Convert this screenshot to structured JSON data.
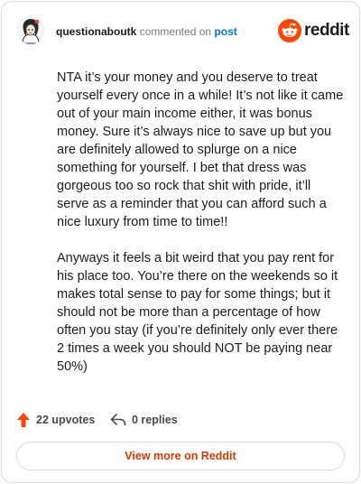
{
  "header": {
    "username": "questionaboutk",
    "verb": "commented on",
    "post_link": "post",
    "brand_name": "reddit"
  },
  "comment": {
    "paragraphs": [
      "NTA it’s your money and you deserve to treat yourself every once in a while! It’s not like it came out of your main income either, it was bonus money. Sure it’s always nice to save up but you are definitely allowed to splurge on a nice something for yourself. I bet that dress was gorgeous too so rock that shit with pride, it’ll serve as a reminder that you can afford such a nice luxury from time to time!!",
      "Anyways it feels a bit weird that you pay rent for his place too. You’re there on the weekends so it makes total sense to pay for some things; but it should not be more than a percentage of how often you stay (if you’re definitely only ever there 2 times a week you should NOT be paying near 50%)"
    ]
  },
  "actions": {
    "upvotes_label": "22 upvotes",
    "replies_label": "0 replies"
  },
  "footer": {
    "view_more_label": "View more on Reddit"
  },
  "colors": {
    "reddit_orange": "#ff4500",
    "upvote_orange": "#ff4500",
    "link_blue": "#0079d3",
    "view_more_text": "#d93a00"
  },
  "icons": {
    "avatar": "user-avatar",
    "logo": "reddit-logo-icon",
    "upvote": "upvote-arrow-icon",
    "reply": "reply-arrow-icon"
  }
}
